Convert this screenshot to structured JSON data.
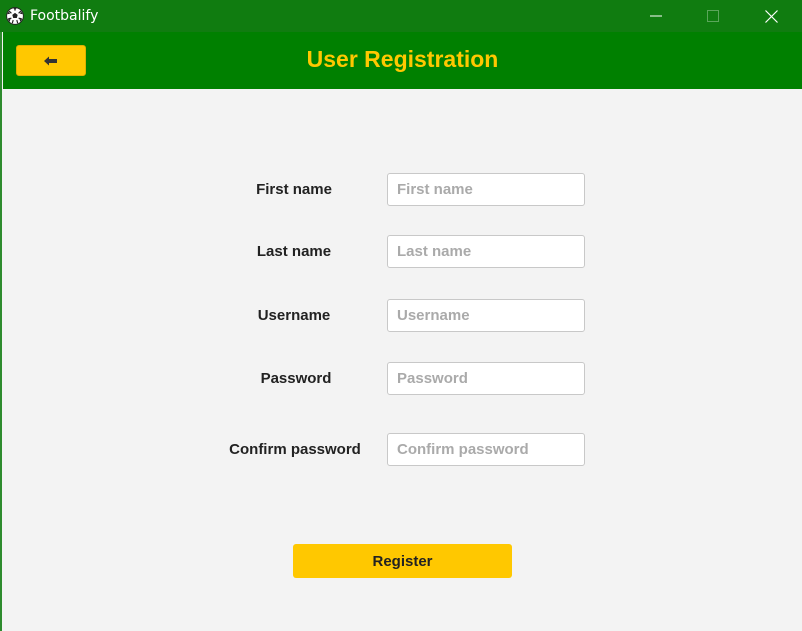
{
  "window": {
    "title": "Footbalify",
    "app_icon": "soccer-ball-icon",
    "controls": [
      "minimize-icon",
      "maximize-icon",
      "close-icon"
    ]
  },
  "header": {
    "title": "User Registration",
    "back_button": {
      "icon": "arrow-left-icon"
    }
  },
  "form": {
    "fields": [
      {
        "label": "First name",
        "placeholder": "First name",
        "value": ""
      },
      {
        "label": "Last name",
        "placeholder": "Last name",
        "value": ""
      },
      {
        "label": "Username",
        "placeholder": "Username",
        "value": ""
      },
      {
        "label": "Password",
        "placeholder": "Password",
        "value": ""
      },
      {
        "label": "Confirm password",
        "placeholder": "Confirm password",
        "value": ""
      }
    ],
    "submit_label": "Register"
  },
  "colors": {
    "titlebar": "#107c10",
    "header": "#008000",
    "accent": "#ffc800",
    "background": "#f3f3f3"
  }
}
